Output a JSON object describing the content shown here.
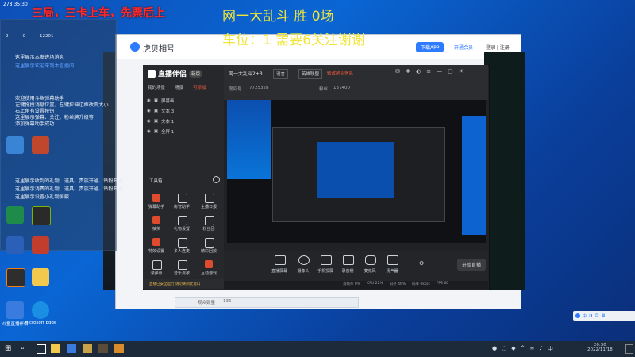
{
  "overlay": {
    "title": "三局，三卡上车，先票后上",
    "stat_line1": "网一大乱斗 胜 0场",
    "stat_line2": "车位：1 需要6关注谢谢",
    "counter": "278:35:30"
  },
  "chat_panel": {
    "viewers": "2",
    "likes": "0",
    "score": "12201",
    "lines": [
      "这里展示本友进场消息",
      "这里展示欢迎来到本直播间",
      "欢迎使用斗鱼弹幕助手",
      "左键拖拽消息位置，左键拉伸边框改变大小",
      "右上角有设置按钮",
      "这里展示弹幕、关注、粉丝牌升级等",
      "添加弹幕助手成功",
      "这里展示收到的礼物、道具、贵族开通、钻粉开通",
      "这里展示消费的礼物、道具、贵族开通、钻粉开通",
      "这里展示设置小礼物屏蔽"
    ]
  },
  "desktop": {
    "icons": [
      "此电脑",
      "回收站",
      "QQ",
      "微信",
      "Excel",
      "NVIDIA",
      "Word",
      "网易云",
      "OBS",
      "文件夹",
      "斗鱼直播伴侣",
      "Microsoft Edge"
    ]
  },
  "browser": {
    "tab_title": "虎贝相号",
    "btn_app": "下载APP",
    "btn_open": "开通会员",
    "btn_login": "登录 | 注册"
  },
  "app": {
    "logo": "直播伴侣",
    "version": "新版",
    "left_tabs": [
      "我的场景",
      "场景",
      "可添加"
    ],
    "scene_items": [
      "屏幕画",
      "文本 3",
      "文本 1",
      "全屏 1"
    ],
    "tool_header": "工具箱",
    "grid": [
      {
        "label": "弹幕助手",
        "accent": true
      },
      {
        "label": "房管助手",
        "accent": false
      },
      {
        "label": "主播日报",
        "accent": false
      },
      {
        "label": "抽奖",
        "accent": true
      },
      {
        "label": "礼物设置",
        "accent": false
      },
      {
        "label": "粉丝团",
        "accent": false
      },
      {
        "label": "特效设置",
        "accent": true
      },
      {
        "label": "多人连麦",
        "accent": false
      },
      {
        "label": "精彩回放",
        "accent": false
      },
      {
        "label": "滚弹幕",
        "accent": false
      },
      {
        "label": "音乐点歌",
        "accent": false
      },
      {
        "label": "互动游戏",
        "accent": true
      }
    ],
    "room_title": "网一大乱斗2+3",
    "room_tag": "语言",
    "room_category": "英雄联盟",
    "room_hint": "修改房间信息",
    "room_id_label": "房间号",
    "room_id": "7725328",
    "fans_label": "粉丝",
    "fans": "137400",
    "toolbar": [
      "直播屏幕",
      "摄像头",
      "手机投屏",
      "录音棚",
      "麦克风",
      "扬声器"
    ],
    "start_btn": "开始直播",
    "status": [
      "丢帧率 0%",
      "CPU 22%",
      "内存 46%",
      "码率 0kb/s",
      "FPS 60"
    ],
    "notice": "直播已安全运行 请勿关闭此窗口",
    "sub_count_label": "观众数量",
    "sub_count": "136"
  },
  "taskbar": {
    "time": "20:30",
    "date": "2022/11/18"
  }
}
